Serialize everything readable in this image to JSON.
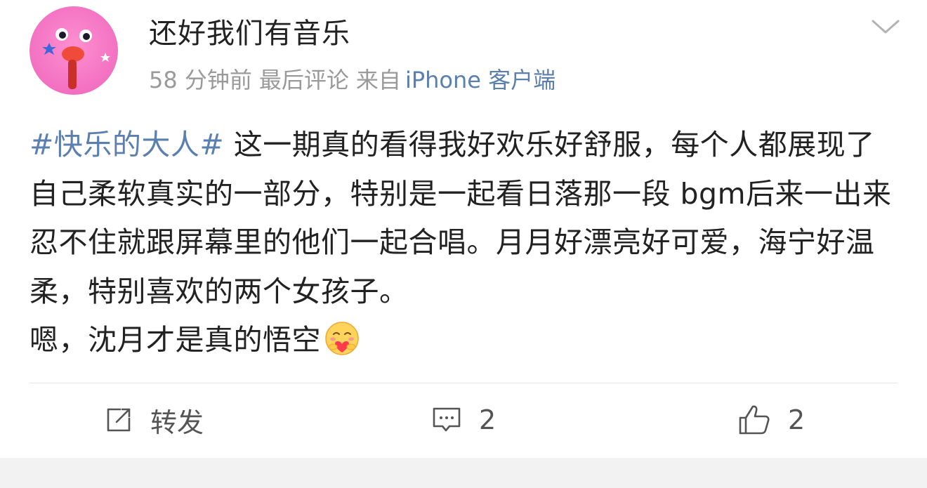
{
  "post": {
    "username": "还好我们有音乐",
    "meta": {
      "time": "58 分钟前",
      "latest_comment": "最后评论",
      "source_prefix": "来自",
      "source_name": "iPhone 客户端"
    },
    "content": {
      "hashtag": "#快乐的大人#",
      "text": " 这一期真的看得我好欢乐好舒服，每个人都展现了自己柔软真实的一部分，特别是一起看日落那一段 bgm后来一出来忍不住就跟屏幕里的他们一起合唱。月月好漂亮好可爱，海宁好温柔，特别喜欢的两个女孩子。",
      "last_line": "嗯，沈月才是真的悟空",
      "emoji": "hugging-heart-emoji"
    }
  },
  "actions": {
    "repost_label": "转发",
    "comment_count": "2",
    "like_count": "2"
  },
  "colors": {
    "link": "#5b7fae",
    "text": "#222222",
    "meta": "#9a9a9a",
    "background_band": "#f2f2f2"
  }
}
